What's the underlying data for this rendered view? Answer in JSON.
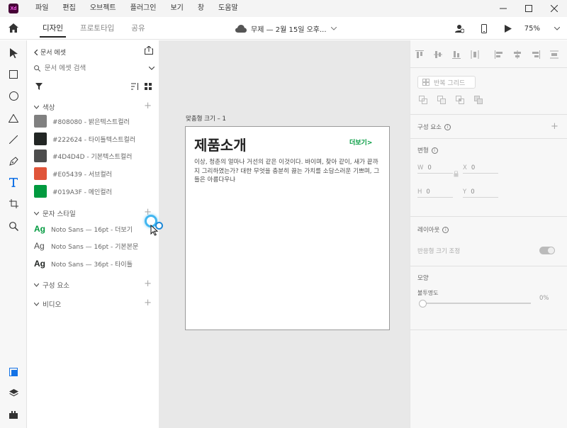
{
  "app": {
    "logo_text": "Xd"
  },
  "menu": [
    "파일",
    "편집",
    "오브젝트",
    "플러그인",
    "보기",
    "창",
    "도움말"
  ],
  "tabs": [
    {
      "label": "디자인",
      "active": true
    },
    {
      "label": "프로토타입",
      "active": false
    },
    {
      "label": "공유",
      "active": false
    }
  ],
  "document": {
    "title": "무제 — 2월 15일 오후..."
  },
  "zoom": "75%",
  "assets": {
    "header": "문서 에셋",
    "search_placeholder": "문서 에셋 검색",
    "colors_section": "색상",
    "colors": [
      {
        "hex": "#808080",
        "label": "#808080 - 밝은텍스트컬러"
      },
      {
        "hex": "#222624",
        "label": "#222624 - 타이틀텍스트컬러"
      },
      {
        "hex": "#4D4D4D",
        "label": "#4D4D4D - 기본텍스트컬러"
      },
      {
        "hex": "#E05439",
        "label": "#E05439 - 서브컬러"
      },
      {
        "hex": "#019A3F",
        "label": "#019A3F - 메인컬러"
      }
    ],
    "char_section": "문자 스타일",
    "char_styles": [
      {
        "ag": "Ag",
        "color": "#019a3f",
        "label": "Noto Sans — 16pt - 더보기"
      },
      {
        "ag": "Ag",
        "color": "#4d4d4d",
        "label": "Noto Sans — 16pt - 기본본문"
      },
      {
        "ag": "Ag",
        "color": "#222624",
        "label": "Noto Sans — 36pt - 타이틀"
      }
    ],
    "components_section": "구성 요소",
    "video_section": "비디오"
  },
  "artboard": {
    "label": "맞춤형 크기 – 1",
    "title": "제품소개",
    "more": "더보기>",
    "body": "이상, 청춘의 얼마나 거선의 같은 이것이다. 바이며, 찾아 같이, 새가 끝까지 그리하였는가? 대한 무엇을 충분히 끓는 가치를 소담스러운 기쁘며, 그들은 아름다우냐"
  },
  "props": {
    "repeat_grid": "반복 그리드",
    "components": "구성 요소",
    "transform": "변형",
    "w_label": "W",
    "w_value": "0",
    "x_label": "X",
    "x_value": "0",
    "h_label": "H",
    "h_value": "0",
    "y_label": "Y",
    "y_value": "0",
    "layout": "레이아웃",
    "responsive": "반응형 크기 조정",
    "appearance": "모양",
    "opacity_label": "불투명도",
    "opacity_value": "0%"
  }
}
